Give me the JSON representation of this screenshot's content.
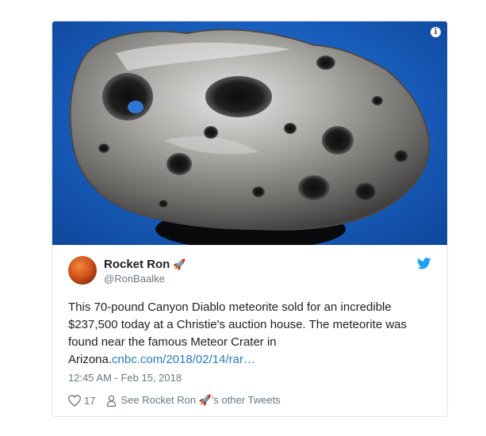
{
  "tweet": {
    "author_name": "Rocket Ron",
    "author_emoji": "🚀",
    "author_handle": "@RonBaalke",
    "text_body": "This 70-pound Canyon Diablo meteorite sold for an incredible $237,500 today at a Christie's auction house.  The meteorite was found near the famous Meteor Crater in Arizona.",
    "link_text": "cnbc.com/2018/02/14/rar…",
    "timestamp": "12:45 AM - Feb 15, 2018",
    "like_count": "17",
    "see_tweets_prefix": "See Rocket Ron",
    "see_tweets_suffix": "'s other Tweets"
  },
  "icons": {
    "info": "info-icon",
    "twitter": "twitter-bird-icon",
    "like": "heart-icon",
    "profile": "person-icon"
  },
  "colors": {
    "link": "#2b7bb9",
    "twitter_blue": "#1da1f2",
    "text": "#1c2022",
    "muted": "#697882"
  }
}
